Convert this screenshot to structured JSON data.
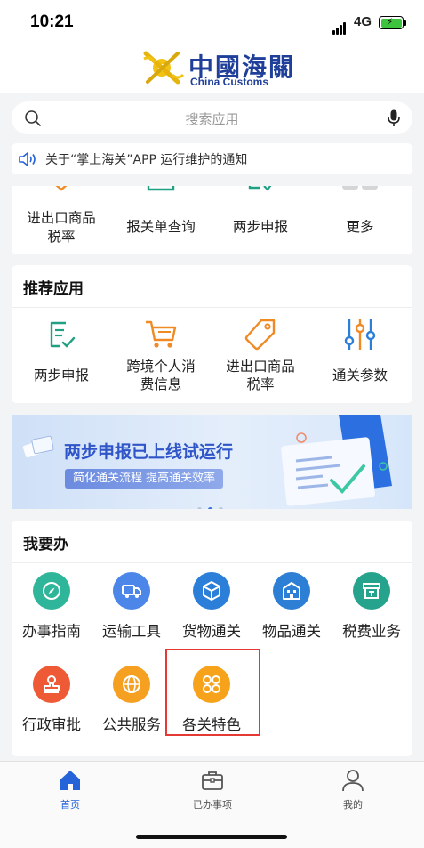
{
  "status_bar": {
    "time": "10:21",
    "network": "4G"
  },
  "header": {
    "logo_cn": "中國海關",
    "logo_en": "China Customs"
  },
  "search": {
    "placeholder": "搜索应用"
  },
  "notice": {
    "text": "关于“掌上海关”APP 运行维护的通知"
  },
  "quick_apps": [
    {
      "label": "进出口商品税率",
      "icon": "tag-icon"
    },
    {
      "label": "报关单查询",
      "icon": "document-icon"
    },
    {
      "label": "两步申报",
      "icon": "declaration-icon"
    },
    {
      "label": "更多",
      "icon": "more-icon"
    }
  ],
  "recommended": {
    "title": "推荐应用",
    "items": [
      {
        "label": "两步申报",
        "icon": "declaration-icon"
      },
      {
        "label": "跨境个人消费信息",
        "icon": "shopping-cart-icon"
      },
      {
        "label": "进出口商品税率",
        "icon": "tag-icon"
      },
      {
        "label": "通关参数",
        "icon": "sliders-icon"
      }
    ]
  },
  "banner": {
    "title": "两步申报已上线试运行",
    "subtitle": "简化通关流程 提高通关效率",
    "active_slide": 2,
    "slide_count": 3
  },
  "todo": {
    "title": "我要办",
    "items": [
      {
        "label": "办事指南",
        "icon": "compass-icon",
        "color": "#2fb69a"
      },
      {
        "label": "运输工具",
        "icon": "truck-icon",
        "color": "#4c86e8"
      },
      {
        "label": "货物通关",
        "icon": "cube-icon",
        "color": "#2b7fd8"
      },
      {
        "label": "物品通关",
        "icon": "building-icon",
        "color": "#2d7fd6"
      },
      {
        "label": "税费业务",
        "icon": "tax-icon",
        "color": "#25a38c"
      },
      {
        "label": "行政审批",
        "icon": "stamp-icon",
        "color": "#ef5a36"
      },
      {
        "label": "公共服务",
        "icon": "globe-icon",
        "color": "#f6a021"
      },
      {
        "label": "各关特色",
        "icon": "grid-petal-icon",
        "color": "#f6a21a"
      }
    ]
  },
  "tabs": [
    {
      "label": "首页",
      "icon": "home-icon",
      "active": true
    },
    {
      "label": "已办事项",
      "icon": "briefcase-icon",
      "active": false
    },
    {
      "label": "我的",
      "icon": "user-icon",
      "active": false
    }
  ],
  "colors": {
    "brand_blue": "#1f3f9a",
    "accent_orange": "#f6a21a",
    "active_tab": "#2563d9",
    "highlight": "#e53935"
  }
}
